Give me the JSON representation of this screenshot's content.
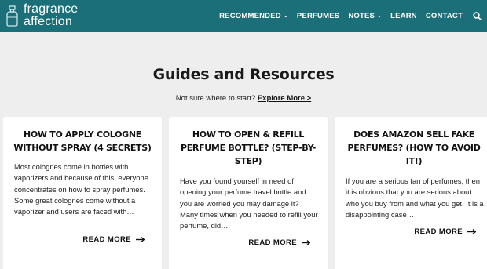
{
  "header": {
    "logo": {
      "line1": "fragrance",
      "line2": "affection"
    },
    "nav": [
      {
        "label": "RECOMMENDED",
        "dropdown": true
      },
      {
        "label": "PERFUMES",
        "dropdown": false
      },
      {
        "label": "NOTES",
        "dropdown": true
      },
      {
        "label": "LEARN",
        "dropdown": false
      },
      {
        "label": "CONTACT",
        "dropdown": false
      }
    ],
    "search_icon": "search-icon"
  },
  "main": {
    "title": "Guides and Resources",
    "subline_text": "Not sure where to start?",
    "subline_link": "Explore More >"
  },
  "cards": [
    {
      "title": "HOW TO APPLY COLOGNE WITHOUT SPRAY (4 SECRETS)",
      "excerpt": "Most colognes come in bottles with vaporizers and because of this, everyone concentrates on how to spray perfumes.  Some great colognes come without a vaporizer and users are faced with…",
      "read_more": "READ MORE"
    },
    {
      "title": "HOW TO OPEN & REFILL PERFUME BOTTLE? (STEP-BY-STEP)",
      "excerpt": "Have you found yourself in need of opening your perfume travel bottle and you are worried you may damage it? Many times when you needed to refill your perfume, did…",
      "read_more": "READ MORE"
    },
    {
      "title": "DOES AMAZON SELL FAKE PERFUMES? (HOW TO AVOID IT!)",
      "excerpt": "If you are a serious fan of perfumes, then it is obvious that you are serious about who you buy from and what you get. It is a disappointing case…",
      "read_more": "READ MORE"
    }
  ],
  "colors": {
    "header_bg": "#1b6f78",
    "page_bg": "#eeeeee",
    "card_bg": "#ffffff"
  }
}
